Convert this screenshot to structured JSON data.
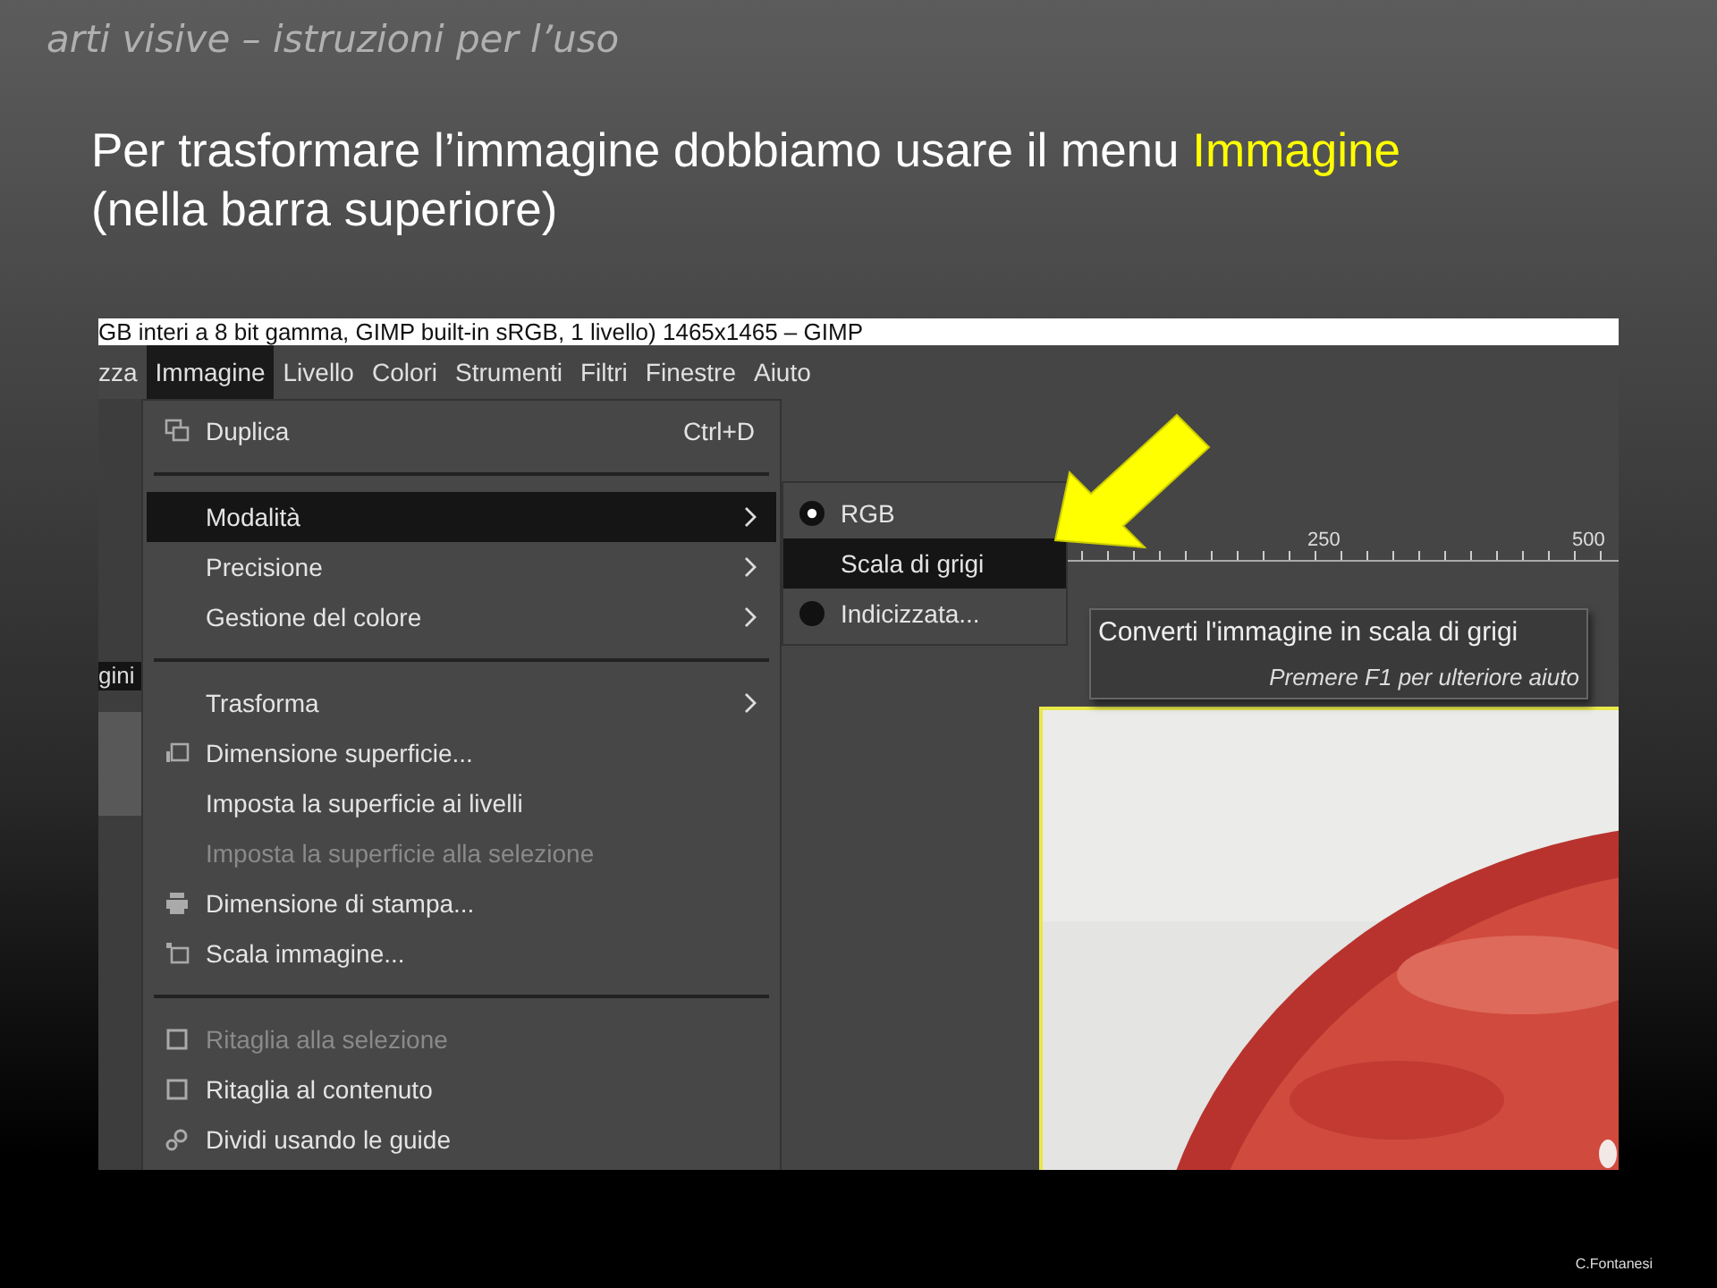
{
  "slide": {
    "header": "arti visive – istruzioni per l’uso",
    "body": [
      [
        {
          "text": "Per trasformare l’immagine dobbiamo usare il menu ",
          "highlight": false
        },
        {
          "text": "Immagine",
          "highlight": true
        }
      ],
      [
        {
          "text": "(nella barra superiore)",
          "highlight": false
        }
      ]
    ],
    "footer": "C.Fontanesi"
  },
  "screenshot": {
    "title": "GB interi a 8 bit gamma, GIMP built-in sRGB, 1 livello) 1465x1465 – GIMP",
    "menubar": [
      {
        "label": "zza",
        "selected": false
      },
      {
        "label": "Immagine",
        "selected": true
      },
      {
        "label": "Livello",
        "selected": false
      },
      {
        "label": "Colori",
        "selected": false
      },
      {
        "label": "Strumenti",
        "selected": false
      },
      {
        "label": "Filtri",
        "selected": false
      },
      {
        "label": "Finestre",
        "selected": false
      },
      {
        "label": "Aiuto",
        "selected": false
      }
    ],
    "side_tab": "gini",
    "menu": [
      {
        "kind": "item",
        "label": "Duplica",
        "shortcut": "Ctrl+D",
        "submenu": false,
        "disabled": false,
        "selected": false
      },
      {
        "kind": "separator"
      },
      {
        "kind": "item",
        "label": "Modalità",
        "submenu": true,
        "disabled": false,
        "selected": true
      },
      {
        "kind": "item",
        "label": "Precisione",
        "submenu": true,
        "disabled": false,
        "selected": false
      },
      {
        "kind": "item",
        "label": "Gestione del colore",
        "submenu": true,
        "disabled": false,
        "selected": false
      },
      {
        "kind": "separator"
      },
      {
        "kind": "item",
        "label": "Trasforma",
        "submenu": true,
        "disabled": false,
        "selected": false
      },
      {
        "kind": "item",
        "label": "Dimensione superficie...",
        "submenu": false,
        "disabled": false,
        "selected": false
      },
      {
        "kind": "item",
        "label": "Imposta la superficie ai livelli",
        "submenu": false,
        "disabled": false,
        "selected": false
      },
      {
        "kind": "item",
        "label": "Imposta la superficie alla selezione",
        "submenu": false,
        "disabled": true,
        "selected": false
      },
      {
        "kind": "item",
        "label": "Dimensione di stampa...",
        "submenu": false,
        "disabled": false,
        "selected": false
      },
      {
        "kind": "item",
        "label": "Scala immagine...",
        "submenu": false,
        "disabled": false,
        "selected": false
      },
      {
        "kind": "separator"
      },
      {
        "kind": "item",
        "label": "Ritaglia alla selezione",
        "submenu": false,
        "disabled": true,
        "selected": false
      },
      {
        "kind": "item",
        "label": "Ritaglia al contenuto",
        "submenu": false,
        "disabled": false,
        "selected": false
      },
      {
        "kind": "item",
        "label": "Dividi usando le guide",
        "submenu": false,
        "disabled": false,
        "selected": false
      }
    ],
    "submenu": [
      {
        "label": "RGB",
        "checked": true,
        "selected": false
      },
      {
        "label": "Scala di grigi",
        "checked": false,
        "selected": true
      },
      {
        "label": "Indicizzata...",
        "checked": false,
        "selected": false
      }
    ],
    "ruler": [
      "250",
      "500"
    ],
    "tooltip": {
      "title": "Converti l'immagine in scala di grigi",
      "hint": "Premere F1 per ulteriore aiuto"
    }
  }
}
